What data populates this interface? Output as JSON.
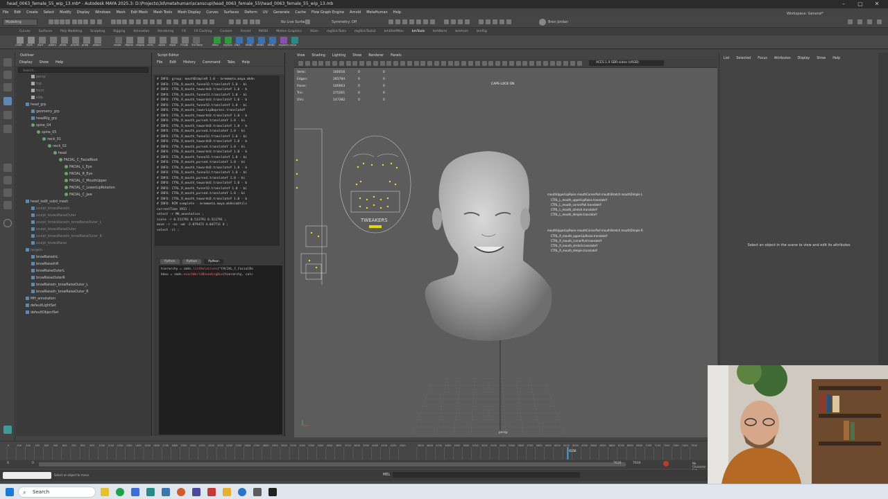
{
  "window": {
    "title": "head_0063_female_55_wip_13.mb* - Autodesk MAYA 2025.3: D:\\Projects\\3d\\metahuman\\scanscup\\head_0063_female_55\\head_0063_female_55_wip_13.mb",
    "workspace_label": "Workspace:",
    "workspace_value": "General*"
  },
  "menus": [
    "File",
    "Edit",
    "Create",
    "Select",
    "Modify",
    "Display",
    "Windows",
    "Mesh",
    "Edit Mesh",
    "Mesh Tools",
    "Mesh Display",
    "Curves",
    "Surfaces",
    "Deform",
    "UV",
    "Generate",
    "Cache",
    "Flow Graph Engine",
    "Arnold",
    "MetaHuman",
    "Help"
  ],
  "status_line": {
    "mode": "Modeling",
    "live_surface": "No Live Surface",
    "symmetry": "Symmetry: Off",
    "user": "Bren Jordan"
  },
  "shelf_tabs": [
    "Curves",
    "Surfaces",
    "Poly Modeling",
    "Sculpting",
    "Rigging",
    "Animation",
    "Rendering",
    "FX",
    "FX Caching",
    "Custom",
    "Arnold",
    "MASH",
    "Motion Graphics",
    "XGen",
    "mgSkinTools",
    "mgSkinTools2",
    "bmShelfMan",
    "bmTools",
    "bmWorm",
    "bmAnim",
    "bmRig"
  ],
  "shelf_active_tab": "bmTools",
  "shelf_labels": [
    "LOAD",
    "SAVE",
    "jSort",
    "pAttrs",
    "pRals",
    "pOnMS",
    "pHeb",
    "pNorm",
    "nodes",
    "rName",
    "shapes",
    "rcnts",
    "cAttrs",
    "skpld",
    "FUnde",
    "3rd Party",
    "Meta",
    "mgSkin",
    "DNA",
    "MHB2",
    "MHB3",
    "MHB2",
    "mgAnim",
    "xxGa"
  ],
  "outliner": {
    "title": "Outliner",
    "menu": [
      "Display",
      "Show",
      "Help"
    ],
    "search_placeholder": "Search...",
    "items": [
      {
        "label": "persp",
        "dim": true
      },
      {
        "label": "top",
        "dim": true
      },
      {
        "label": "front",
        "dim": true
      },
      {
        "label": "side",
        "dim": true
      },
      {
        "label": "head_grp",
        "dim": false
      },
      {
        "label": "geometry_grp",
        "dim": false
      },
      {
        "label": "headRig_grp",
        "dim": false
      },
      {
        "label": "spine_04",
        "dim": false
      },
      {
        "label": "spine_05",
        "dim": false
      },
      {
        "label": "neck_01",
        "dim": false
      },
      {
        "label": "neck_02",
        "dim": false
      },
      {
        "label": "head",
        "dim": false
      },
      {
        "label": "FACIAL_C_FacialRoot",
        "dim": false
      },
      {
        "label": "FACIAL_L_Eye",
        "dim": false
      },
      {
        "label": "FACIAL_R_Eye",
        "dim": false
      },
      {
        "label": "FACIAL_C_MouthUpper",
        "dim": false
      },
      {
        "label": "FACIAL_C_LowerLipRotation",
        "dim": false
      },
      {
        "label": "FACIAL_C_Jaw",
        "dim": false
      },
      {
        "label": "head_lod0_subd_mesh",
        "dim": false
      },
      {
        "label": "sculpt_browsRaiseIn",
        "dim": true
      },
      {
        "label": "sculpt_browsRaiseOuter",
        "dim": true
      },
      {
        "label": "sculpt_browsRaiseIn_browRaiseOuter_L",
        "dim": true
      },
      {
        "label": "sculpt_browsRaiseOuter",
        "dim": true
      },
      {
        "label": "sculpt_browsRaiseIn_browRaiseOuter_R",
        "dim": true
      },
      {
        "label": "sculpt_browsRaise",
        "dim": true
      },
      {
        "label": "targets",
        "dim": true
      },
      {
        "label": "browRaiseInL",
        "dim": false
      },
      {
        "label": "browRaiseInR",
        "dim": false
      },
      {
        "label": "browRaiseOuterL",
        "dim": false
      },
      {
        "label": "browRaiseOuterR",
        "dim": false
      },
      {
        "label": "browRaiseIn_browRaiseOuter_L",
        "dim": false
      },
      {
        "label": "browRaiseIn_browRaiseOuter_R",
        "dim": false
      },
      {
        "label": "MH_annotation",
        "dim": false
      },
      {
        "label": "defaultLightSet",
        "dim": false
      },
      {
        "label": "defaultObjectSet",
        "dim": false
      }
    ]
  },
  "script_editor": {
    "title": "Script Editor",
    "menu": [
      "File",
      "Edit",
      "History",
      "Command",
      "Tabs",
      "Help"
    ],
    "output_lines": [
      "# INFO: group: mouthDimpleR 1.0 - bremmeta.maya.mhAn",
      "# INFO:   CTRL_R_mouth_funnelD.translateY 1.0 - bi",
      "# INFO:   CTRL_R_mouth_towardsD.translateY 1.0 - b",
      "# INFO:   CTRL_R_mouth_funnelU.translateY 1.0 - bi",
      "# INFO:   CTRL_R_mouth_towardsU.translateY 1.0 - b",
      "# INFO:   CTRL_R_mouth_funnelD.translateY 1.0 - bi",
      "# INFO:   CTRL_R_mouth_lowerLipDepress.translateY",
      "# INFO:   CTRL_R_mouth_towardsU.translateY 1.0 - b",
      "# INFO:   CTRL_R_mouth_pursed.translateY 1.0 - bi",
      "# INFO:   CTRL_R_mouth_towardsD.translateY 1.0 - b",
      "# INFO:   CTRL_R_mouth_pursed.translateY 1.0 - bi",
      "# INFO:   CTRL_R_mouth_funnelU.translateY 1.0 - bi",
      "# INFO:   CTRL_R_mouth_towardsD.translateY 1.0 - b",
      "# INFO:   CTRL_R_mouth_pursed.translateY 1.0 - bi",
      "# INFO:   CTRL_R_mouth_towardsU.translateY 1.0 - b",
      "# INFO:   CTRL_R_mouth_funnelD.translateY 1.0 - bi",
      "# INFO:   CTRL_R_mouth_pursed.translateY 1.0 - bi",
      "# INFO:   CTRL_R_mouth_towardsD.translateY 1.0 - b",
      "# INFO:   CTRL_R_mouth_funnelU.translateY 1.0 - bi",
      "# INFO:   CTRL_R_mouth_pursed.translateY 1.0 - bi",
      "# INFO:   CTRL_R_mouth_towardsU.translateY 1.0 - b",
      "# INFO:   CTRL_R_mouth_funnelD.translateY 1.0 - bi",
      "# INFO:   CTRL_R_mouth_pursed.translateY 1.0 - bi",
      "# INFO:   CTRL_R_mouth_towardsD.translateY 1.0 - b",
      "# INFO: RCM complete - bremmeta.maya.mhAnimUtils",
      "currentTime 3911 ;",
      "select -r MH_annotation ;",
      "scale -r 0.511791 0.511791 0.511791 ;",
      "move -r -os -wd -2.079473 4.047711 0 ;",
      "select -cl ;"
    ],
    "tabs": [
      "Python",
      "Python",
      "Python"
    ],
    "input_lines": [
      {
        "pre": "hierarchy = cmds.",
        "fn": "listRelatives",
        "post": "(\"FACIAL_C_FacialRo"
      },
      {
        "pre": "bbox = cmds.",
        "fn": "exactWorldBoundingBox",
        "post": "(hierarchy, calc"
      }
    ]
  },
  "viewport": {
    "menu": [
      "View",
      "Shading",
      "Lighting",
      "Show",
      "Renderer",
      "Panels"
    ],
    "color_space": "ACES 1.0 SDR-video (sRGB)",
    "hud": [
      {
        "label": "Verts:",
        "v1": "160016",
        "v2": "0",
        "v3": "0"
      },
      {
        "label": "Edges:",
        "v1": "283784",
        "v2": "0",
        "v3": "0"
      },
      {
        "label": "Faces:",
        "v1": "140663",
        "v2": "0",
        "v3": "0"
      },
      {
        "label": "Tris:",
        "v1": "275261",
        "v2": "0",
        "v3": "0"
      },
      {
        "label": "UVs:",
        "v1": "147382",
        "v2": "0",
        "v3": "0"
      }
    ],
    "caps_lock": "CAPS LOCK ON",
    "camera": "persp",
    "tweakers_label": "TWEAKERS",
    "annotation_upper": "mouthUpperLipRaise mouthCornerPull mouthStretch mouthDimple L",
    "annotation_upper_lines": [
      "CTRL_L_mouth_upperLipRaise.translateY",
      "CTRL_L_mouth_cornerPull.translateY",
      "CTRL_L_mouth_stretch.translateY",
      "CTRL_L_mouth_dimple.translateY"
    ],
    "annotation_lower": "mouthUpperLipRaise mouthCornerPull mouthStretch mouthDimple R",
    "annotation_lower_lines": [
      "CTRL_R_mouth_upperLipRaise.translateY",
      "CTRL_R_mouth_cornerPull.translateY",
      "CTRL_R_mouth_stretch.translateY",
      "CTRL_R_mouth_dimple.translateY"
    ]
  },
  "attribute_editor": {
    "tabs": [
      "List",
      "Selected",
      "Focus",
      "Attributes",
      "Display",
      "Show",
      "Help"
    ],
    "message": "Select an object in the scene to view and edit its attributes"
  },
  "timeline": {
    "ticks": [
      "0",
      "100",
      "200",
      "300",
      "400",
      "500",
      "600",
      "700",
      "800",
      "900",
      "1000",
      "1100",
      "1200",
      "1300",
      "1400",
      "1500",
      "1600",
      "1700",
      "1800",
      "1900",
      "2000",
      "2100",
      "2200",
      "2300",
      "2400",
      "2500",
      "2600",
      "2700",
      "2800",
      "2900",
      "3000",
      "3100",
      "3200",
      "3300",
      "3400",
      "3500",
      "3600",
      "3700",
      "3800",
      "3900",
      "4000",
      "4100",
      "4200",
      "4300",
      "4500",
      "4600",
      "4700",
      "4800",
      "4900",
      "5000",
      "5100",
      "5200",
      "5300",
      "5400",
      "5500",
      "5600",
      "5700",
      "5800",
      "5900",
      "6000",
      "6100",
      "6200",
      "6300",
      "6400",
      "6500",
      "6600",
      "6700",
      "6800",
      "6900",
      "7000",
      "7100",
      "7200",
      "7300",
      "7400",
      "7500"
    ],
    "current_frame_label": "6156",
    "range_start": "0",
    "range_start2": "0",
    "range_end": "7630",
    "range_end2": "7630",
    "char_set": "No Character Set"
  },
  "command_line": {
    "lang": "MEL",
    "hint": "Select an object to move."
  },
  "taskbar": {
    "search": "Search"
  }
}
